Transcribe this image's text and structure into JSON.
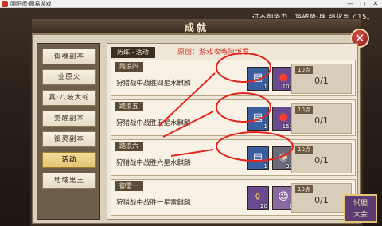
{
  "window": {
    "title": "阴阳师-网易游戏",
    "controls": [
      "—",
      "□",
      "✕"
    ]
  },
  "marquee": "过不御势力，将破势·肆 强化到了15。",
  "panel": {
    "title": "成就",
    "close_label": "✕"
  },
  "sidebar": {
    "items": [
      {
        "label": "御魂副本",
        "active": false
      },
      {
        "label": "业原火",
        "active": false
      },
      {
        "label": "真·八岐大蛇",
        "active": false
      },
      {
        "label": "觉醒副本",
        "active": false
      },
      {
        "label": "御灵副本",
        "active": false
      },
      {
        "label": "活动",
        "active": true
      },
      {
        "label": "地域鬼王",
        "active": false
      }
    ]
  },
  "content": {
    "tab_label": "历练 - 活动",
    "watermark": "原创：游戏攻略阿饭君",
    "rows": [
      {
        "name": "踏浪四",
        "desc": "狩猎战中战胜四星水麒麟",
        "points": "10点",
        "progress": "0/1",
        "rewards": [
          {
            "icon": "scroll-icon",
            "qty": "1"
          },
          {
            "icon": "daruma-icon",
            "qty": "100"
          }
        ]
      },
      {
        "name": "踏浪五",
        "desc": "狩猎战中战胜五星水麒麟",
        "points": "10点",
        "progress": "0/1",
        "rewards": [
          {
            "icon": "scroll-icon",
            "qty": "1"
          },
          {
            "icon": "daruma-icon",
            "qty": "150"
          }
        ]
      },
      {
        "name": "踏浪六",
        "desc": "狩猎战中战胜六星水麒麟",
        "points": "10点",
        "progress": "0/1",
        "rewards": [
          {
            "icon": "scroll-icon",
            "qty": "1"
          },
          {
            "icon": "coin-icon",
            "qty": "30"
          },
          {
            "icon": "talisman-icon",
            "qty": "1"
          }
        ]
      },
      {
        "name": "御雷一",
        "desc": "狩猎战中战胜一星雷麒麟",
        "points": "10点",
        "progress": "0/1",
        "rewards": [
          {
            "icon": "potion-icon",
            "qty": "20"
          },
          {
            "icon": "character-icon",
            "qty": "1"
          }
        ]
      }
    ]
  },
  "bottom_badge": {
    "line1": "试胆",
    "line2": "大会"
  },
  "colors": {
    "annotation_red": "#e3241c",
    "accent_gold": "#e2c472",
    "panel_dark": "#3a2d22"
  }
}
